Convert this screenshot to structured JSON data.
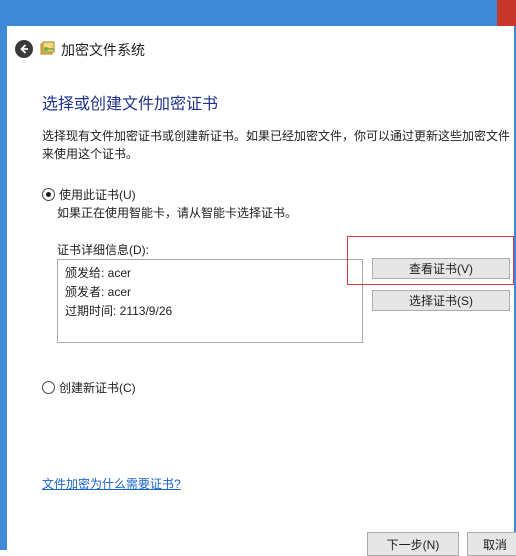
{
  "window": {
    "title": "加密文件系统",
    "icons": {
      "back": "back-arrow-icon",
      "app": "efs-key-icon"
    }
  },
  "page": {
    "heading": "选择或创建文件加密证书",
    "description": "选择现有文件加密证书或创建新证书。如果已经加密文件，你可以通过更新这些加密文件来使用这个证书。"
  },
  "option_use_cert": {
    "label": "使用此证书(U)",
    "selected": true,
    "hint": "如果正在使用智能卡，请从智能卡选择证书。"
  },
  "cert_details": {
    "label": "证书详细信息(D):",
    "issued_to": "颁发给: acer",
    "issued_by": "颁发者: acer",
    "expires": "过期时间: 2113/9/26"
  },
  "buttons": {
    "view_cert": "查看证书(V)",
    "select_cert": "选择证书(S)",
    "next": "下一步(N)",
    "cancel": "取消"
  },
  "option_create_cert": {
    "label": "创建新证书(C)",
    "selected": false
  },
  "help_link": "文件加密为什么需要证书?",
  "colors": {
    "frame": "#3f8ad6",
    "heading": "#1e3287",
    "link": "#1a63c8",
    "highlight": "#d9373e"
  }
}
